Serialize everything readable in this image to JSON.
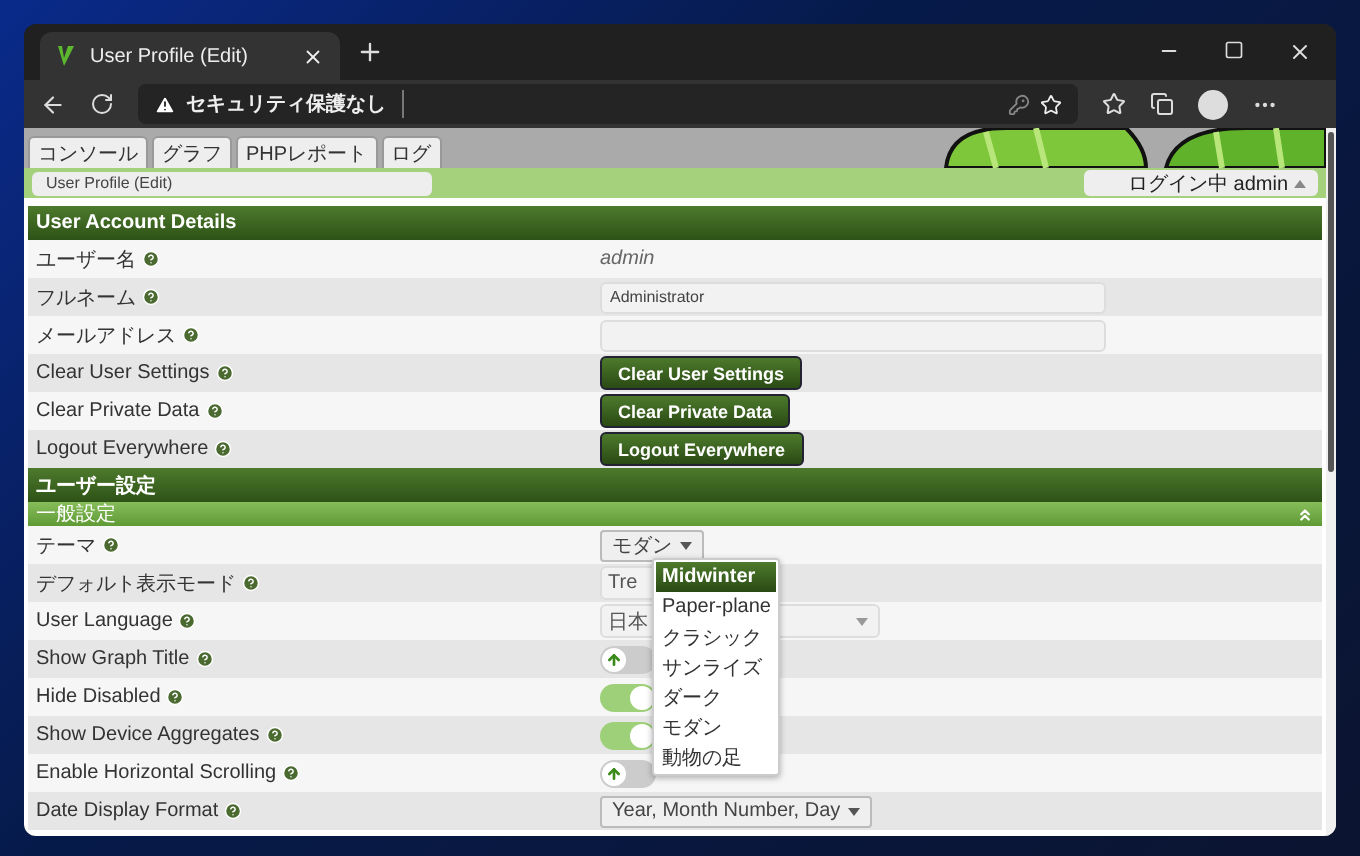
{
  "browser": {
    "tab_title": "User Profile (Edit)",
    "address_warning": "セキュリティ保護なし"
  },
  "nav_tabs": [
    {
      "label": "コンソール"
    },
    {
      "label": "グラフ"
    },
    {
      "label": "PHPレポート"
    },
    {
      "label": "ログ"
    }
  ],
  "breadcrumb": "User Profile (Edit)",
  "login": "ログイン中 admin",
  "account": {
    "title": "User Account Details",
    "rows": [
      {
        "label": "ユーザー名",
        "kind": "text",
        "value": "admin"
      },
      {
        "label": "フルネーム",
        "kind": "input",
        "value": "Administrator"
      },
      {
        "label": "メールアドレス",
        "kind": "input",
        "value": ""
      },
      {
        "label": "Clear User Settings",
        "kind": "button",
        "value": "Clear User Settings"
      },
      {
        "label": "Clear Private Data",
        "kind": "button",
        "value": "Clear Private Data"
      },
      {
        "label": "Logout Everywhere",
        "kind": "button",
        "value": "Logout Everywhere"
      }
    ]
  },
  "user_settings": {
    "title": "ユーザー設定",
    "subsection": "一般設定",
    "rows": [
      {
        "label": "テーマ",
        "kind": "menu",
        "value": "モダン"
      },
      {
        "label": "デフォルト表示モード",
        "kind": "select",
        "value": "Tre"
      },
      {
        "label": "User Language",
        "kind": "select",
        "value": "日本"
      },
      {
        "label": "Show Graph Title",
        "kind": "toggle",
        "on": false
      },
      {
        "label": "Hide Disabled",
        "kind": "toggle",
        "on": true
      },
      {
        "label": "Show Device Aggregates",
        "kind": "toggle",
        "on": true
      },
      {
        "label": "Enable Horizontal Scrolling",
        "kind": "toggle",
        "on": false
      },
      {
        "label": "Date Display Format",
        "kind": "menu",
        "value": "Year, Month Number, Day"
      }
    ]
  },
  "theme_menu": [
    {
      "label": "Midwinter",
      "selected": true
    },
    {
      "label": "Paper-plane",
      "selected": false
    },
    {
      "label": "クラシック",
      "selected": false
    },
    {
      "label": "サンライズ",
      "selected": false
    },
    {
      "label": "ダーク",
      "selected": false
    },
    {
      "label": "モダン",
      "selected": false
    },
    {
      "label": "動物の足",
      "selected": false
    }
  ]
}
